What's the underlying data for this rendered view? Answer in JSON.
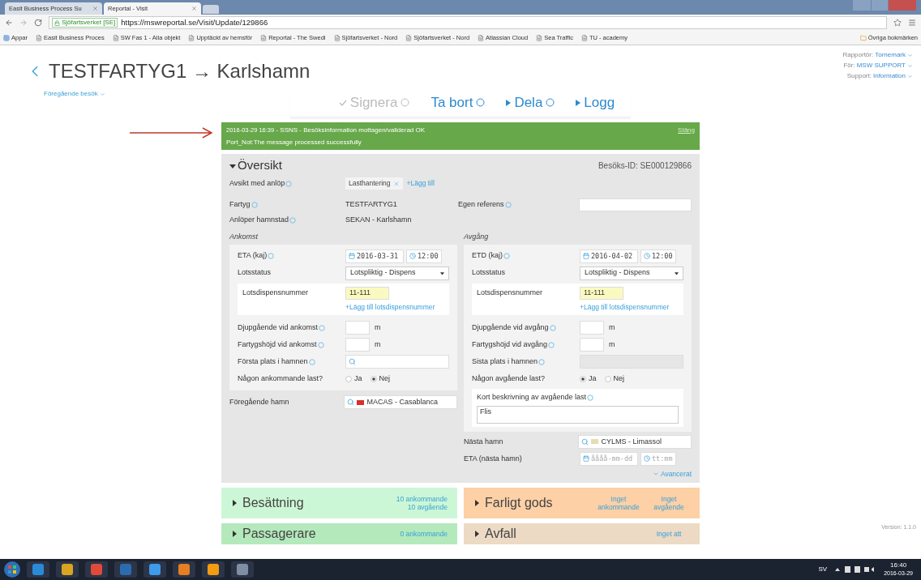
{
  "browser": {
    "tabs": [
      {
        "label": "Easit Business Process Su",
        "selected": false
      },
      {
        "label": "Reportal - Visit",
        "selected": true
      }
    ],
    "security_badge": "Sjöfartsverket [SE]",
    "url": "https://mswreportal.se/Visit/Update/129866",
    "bookmarks": [
      "Appar",
      "Easit Business Proces",
      "SW Fas 1 - Alla objekt",
      "Upptäckt av hemsför",
      "Reportal - The Swedi",
      "Sjöfartsverket - Nord",
      "Sjöfartsverket - Nord",
      "Atlassian Cloud",
      "Sea Traffic",
      "TU - academy"
    ],
    "other_bookmarks": "Övriga bokmärken"
  },
  "header": {
    "title": "TESTFARTYG1 → Karlshamn",
    "previous_visits": "Föregående besök",
    "user_menu": [
      {
        "label": "Rapportör:",
        "value": "Tornemark"
      },
      {
        "label": "För:",
        "value": "MSW SUPPORT"
      },
      {
        "label": "Support:",
        "value": "Information"
      }
    ]
  },
  "actions": [
    {
      "label": "Signera",
      "kind": "check",
      "disabled": true,
      "help": true
    },
    {
      "label": "Ta bort",
      "kind": "plain",
      "disabled": false,
      "help": true
    },
    {
      "label": "Dela",
      "kind": "expand",
      "disabled": false,
      "help": true
    },
    {
      "label": "Logg",
      "kind": "expand",
      "disabled": false,
      "help": false
    }
  ],
  "notification": {
    "time": "2016-03-29 16:39",
    "title": " - SSNS - Besöksinformation mottagen/validerad OK",
    "message": "Port_Not:The message processed successfully",
    "close": "Stäng"
  },
  "overview": {
    "title": "Översikt",
    "expanded": true,
    "visit_id": "Besöks-ID: SE000129866",
    "purpose": {
      "label": {
        "text": "Avsikt med anlöp",
        "help": true
      },
      "tags": [
        "Lasthantering"
      ],
      "add": "+Lägg till"
    },
    "vessel": {
      "label": {
        "text": "Fartyg",
        "help": true
      },
      "value": "TESTFARTYG1"
    },
    "own_reference": {
      "label": {
        "text": "Egen referens",
        "help": true
      }
    },
    "port": {
      "label": {
        "text": "Anlöper hamnstad",
        "help": true
      },
      "value": "SEKAN - Karlshamn"
    },
    "arrival": {
      "heading": "Ankomst",
      "time_label": {
        "text": "ETA (kaj)",
        "help": true
      },
      "date": "2016-03-31",
      "time": "12:00",
      "pilot_label": {
        "text": "Lotsstatus",
        "help": false
      },
      "pilot_status": "Lotspliktig - Dispens",
      "dispens_label": "Lotsdispensnummer",
      "dispens_value": "11-111",
      "add_dispens": "+Lägg till lotsdispensnummer",
      "draft_label": {
        "text": "Djupgående vid ankomst",
        "help": true
      },
      "draft_unit": "m",
      "height_label": {
        "text": "Fartygshöjd vid ankomst",
        "help": true
      },
      "height_unit": "m",
      "place_label": {
        "text": "Första plats i hamnen",
        "help": true
      },
      "place_disabled": false,
      "cargo_label": {
        "text": "Någon ankommande last?",
        "help": false
      },
      "cargo_options": [
        {
          "label": "Ja",
          "selected": false
        },
        {
          "label": "Nej",
          "selected": true
        }
      ]
    },
    "departure": {
      "heading": "Avgång",
      "time_label": {
        "text": "ETD (kaj)",
        "help": true
      },
      "date": "2016-04-02",
      "time": "12:00",
      "pilot_label": {
        "text": "Lotsstatus",
        "help": false
      },
      "pilot_status": "Lotspliktig - Dispens",
      "dispens_label": "Lotsdispensnummer",
      "dispens_value": "11-111",
      "add_dispens": "+Lägg till lotsdispensnummer",
      "draft_label": {
        "text": "Djupgående vid avgång",
        "help": true
      },
      "draft_unit": "m",
      "height_label": {
        "text": "Fartygshöjd vid avgång",
        "help": true
      },
      "height_unit": "m",
      "place_label": {
        "text": "Sista plats i hamnen",
        "help": true
      },
      "place_disabled": true,
      "cargo_label": {
        "text": "Någon avgående last?",
        "help": false
      },
      "cargo_options": [
        {
          "label": "Ja",
          "selected": true
        },
        {
          "label": "Nej",
          "selected": false
        }
      ],
      "cargo_description": {
        "label": {
          "text": "Kort beskrivning av avgående last",
          "help": true
        },
        "value": "Flis"
      }
    },
    "previous_port": {
      "label": "Föregående hamn",
      "value": "MACAS - Casablanca",
      "color": "#d9302c"
    },
    "next_port": {
      "label": "Nästa hamn",
      "value": "CYLMS - Limassol",
      "color": "#e6dcb0"
    },
    "next_eta": {
      "label": "ETA (nästa hamn)",
      "date_placeholder": "åååå-mm-dd",
      "time_placeholder": "tt:mm"
    },
    "advanced": "Avancerat"
  },
  "cards": [
    {
      "title": "Besättning",
      "color": "#ccf7d6",
      "kind": "stack",
      "notes": [
        "10 ankommande",
        "10 avgående"
      ]
    },
    {
      "title": "Farligt gods",
      "color": "#fdd0a6",
      "kind": "columns",
      "notes": [
        "Inget ankommande",
        "Inget avgående"
      ]
    },
    {
      "title": "Passagerare",
      "color": "#b4e9bc",
      "kind": "stack",
      "notes": [
        "0 ankommande"
      ]
    },
    {
      "title": "Avfall",
      "color": "#ecdac4",
      "kind": "columns",
      "notes": [
        "Inget att"
      ]
    }
  ],
  "version": "Version: 1.1.0",
  "taskbar": {
    "language": "SV",
    "time": "16:40",
    "date": "2016-03-29"
  }
}
